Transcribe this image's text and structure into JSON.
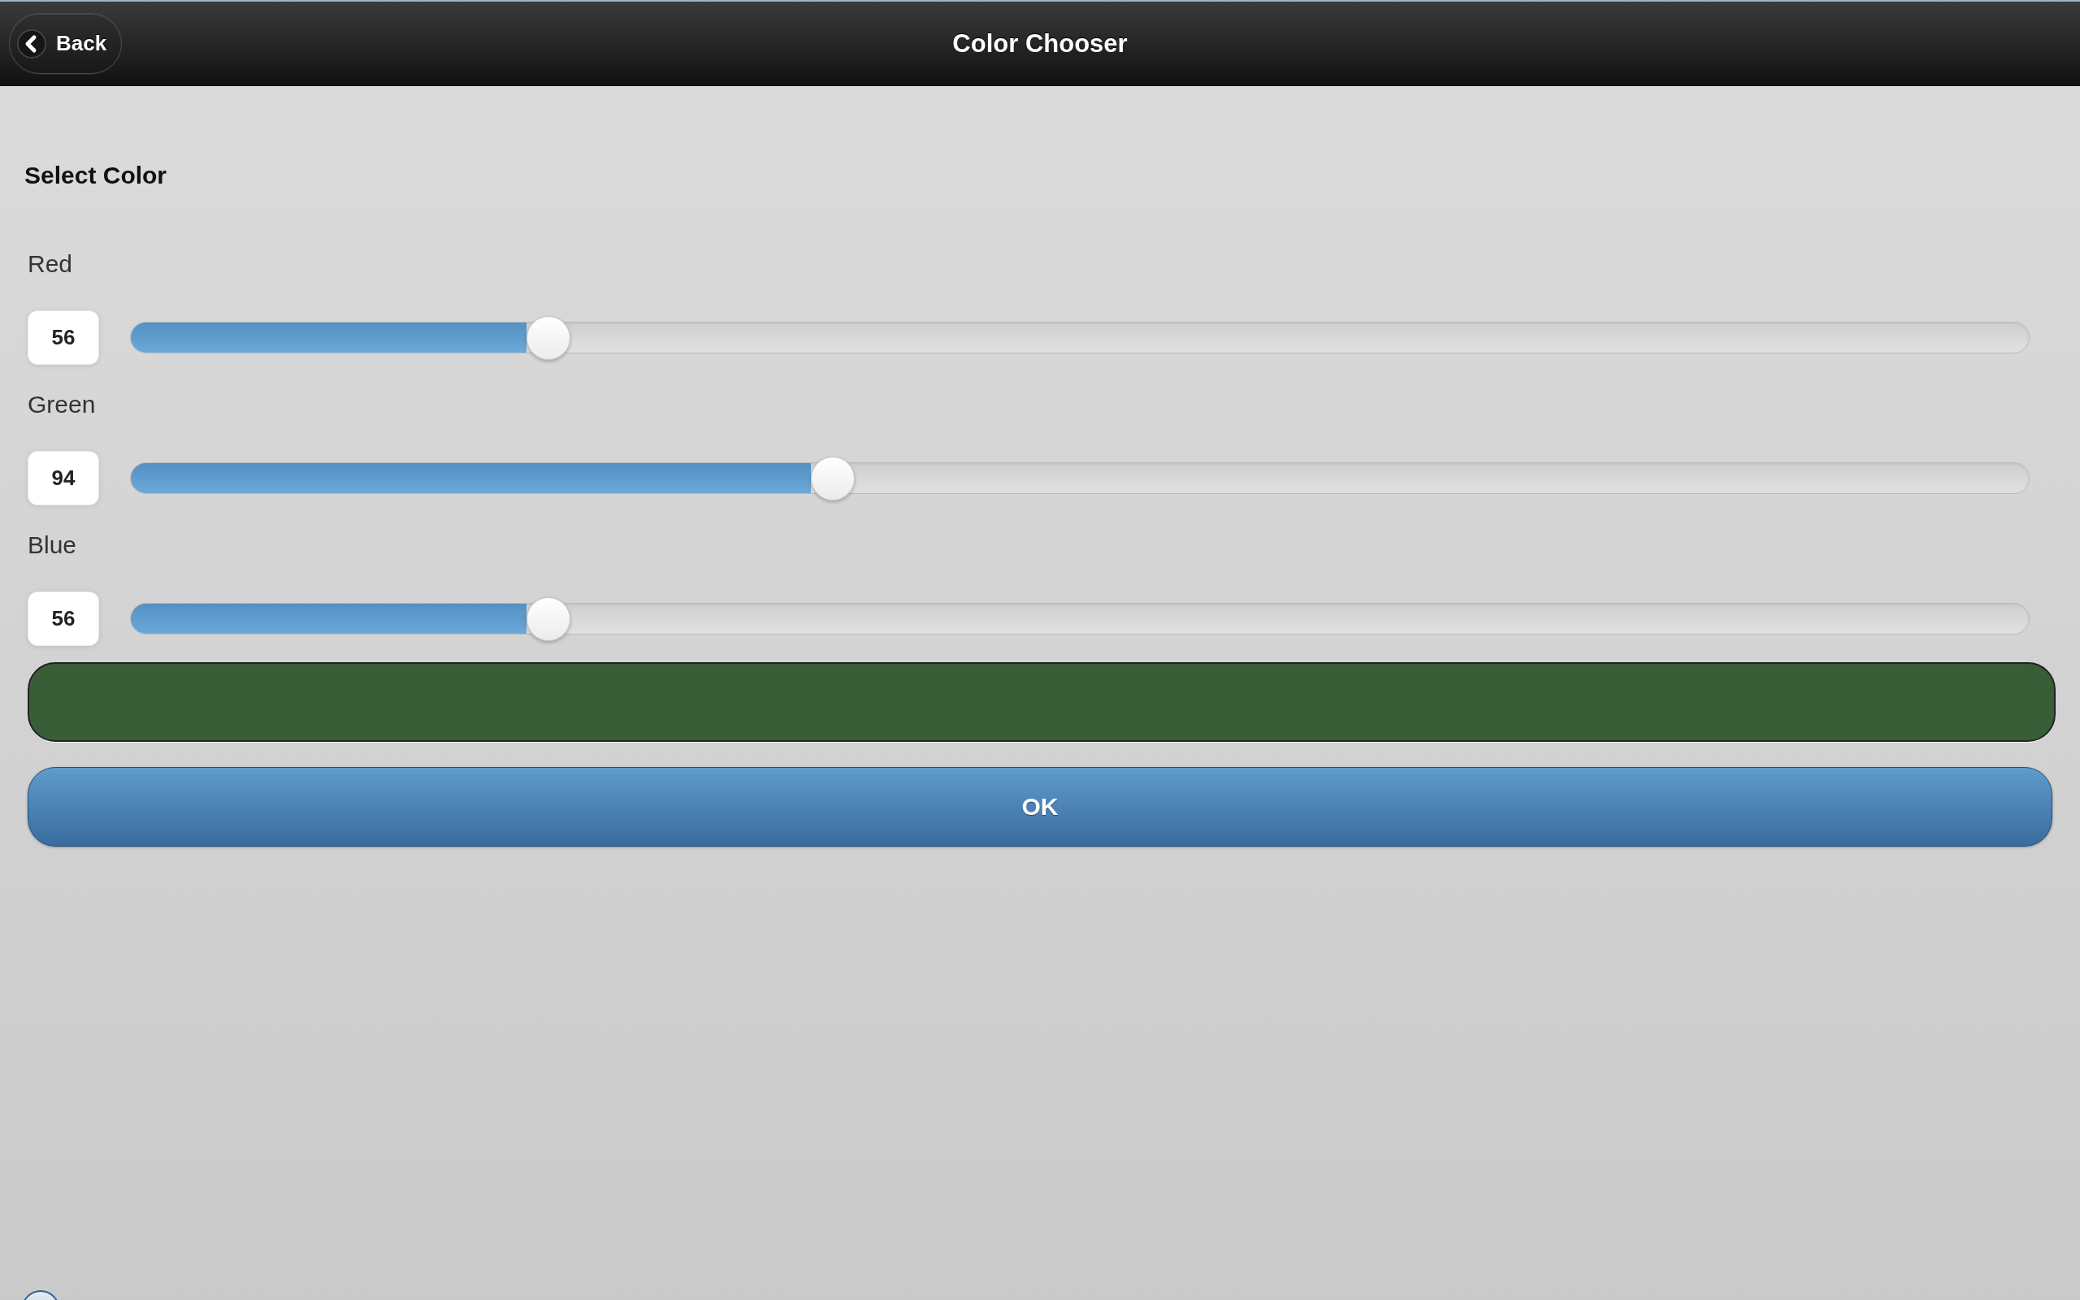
{
  "header": {
    "title": "Color Chooser",
    "back_button": {
      "label": "Back"
    }
  },
  "section_title": "Select Color",
  "channels": [
    {
      "label": "Red",
      "value": "56",
      "level": 0.22
    },
    {
      "label": "Green",
      "value": "94",
      "level": 0.37
    },
    {
      "label": "Blue",
      "value": "56",
      "level": 0.22
    }
  ],
  "color_preview": {
    "color": "#385e38"
  },
  "ok_button": {
    "label": "OK"
  }
}
